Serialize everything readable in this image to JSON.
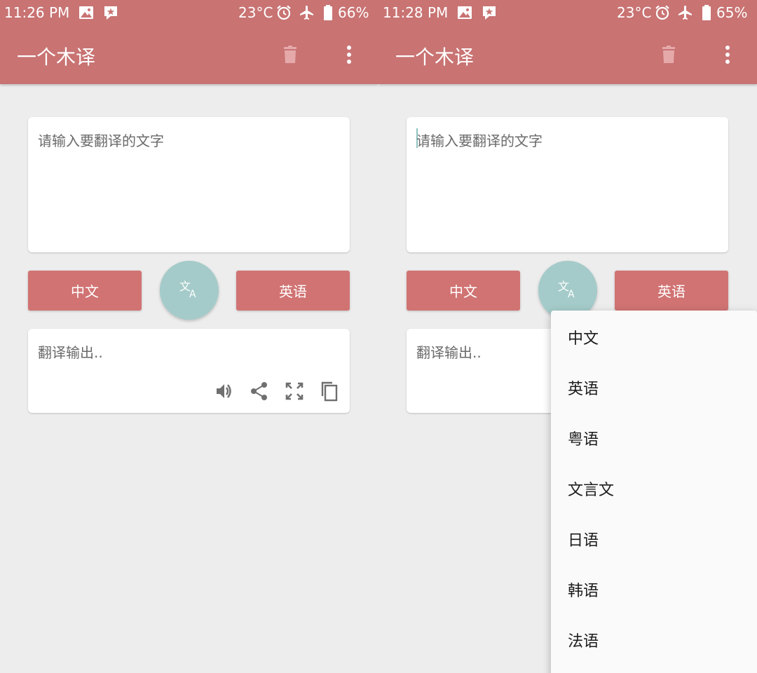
{
  "app_title": "一个木译",
  "input_placeholder": "请输入要翻译的文字",
  "output_placeholder": "翻译输出..",
  "source_lang": "中文",
  "target_lang": "英语",
  "left": {
    "status": {
      "time": "11:26 PM",
      "temp": "23°C",
      "battery": "66%"
    }
  },
  "right": {
    "status": {
      "time": "11:28 PM",
      "temp": "23°C",
      "battery": "65%"
    }
  },
  "language_menu": {
    "items": [
      "中文",
      "英语",
      "粤语",
      "文言文",
      "日语",
      "韩语",
      "法语"
    ]
  },
  "icons": {
    "delete": "trash-icon",
    "more": "more-vertical-icon",
    "translate": "translate-icon",
    "speak": "volume-icon",
    "share": "share-icon",
    "fullscreen": "fullscreen-icon",
    "copy": "copy-icon"
  },
  "colors": {
    "primary": "#c97373",
    "button": "#d17373",
    "fab": "#a4cbc9",
    "background": "#ededed"
  }
}
